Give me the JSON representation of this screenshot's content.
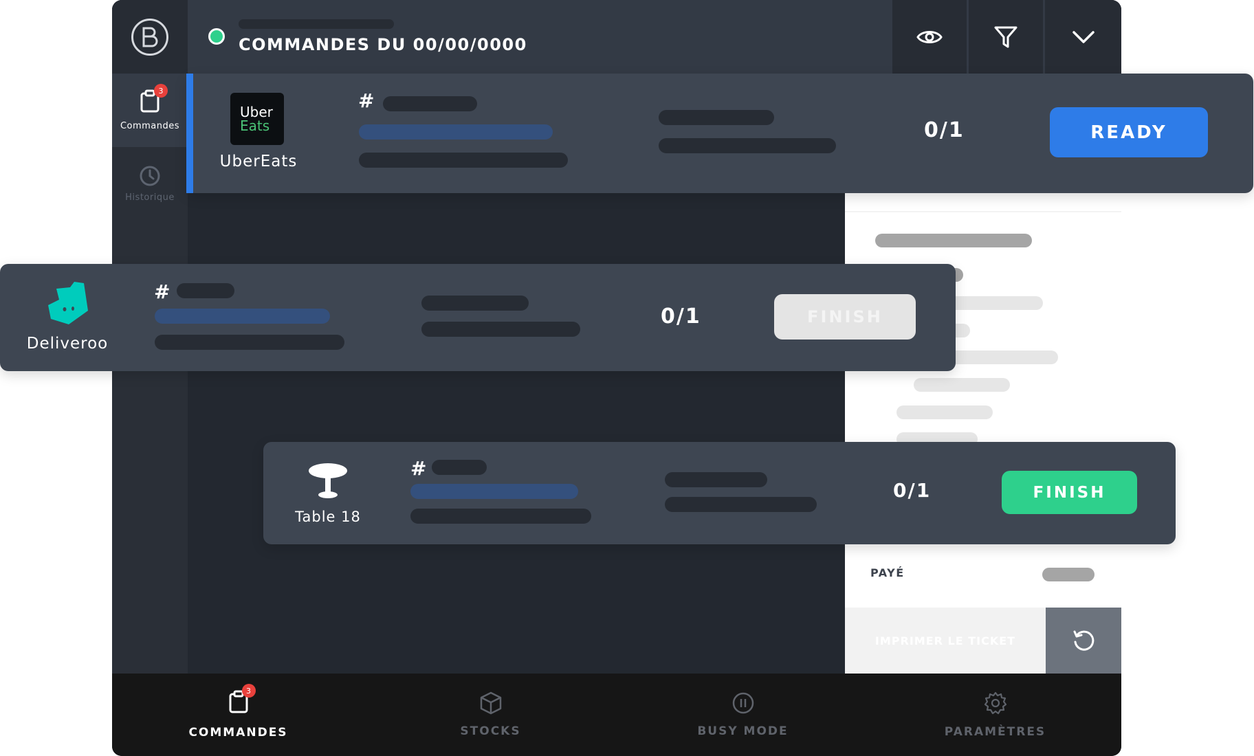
{
  "header": {
    "title": "COMMANDES DU 00/00/0000",
    "tools": [
      "eye-icon",
      "filter-icon",
      "chevron-down-icon"
    ]
  },
  "sidebar": {
    "items": [
      {
        "label": "Commandes",
        "icon": "clipboard-icon",
        "badge": "3",
        "active": true
      },
      {
        "label": "Historique",
        "icon": "clock-icon",
        "active": false
      }
    ]
  },
  "orders": [
    {
      "source": "UberEats",
      "hash": "#",
      "count": "0/1",
      "action": "READY",
      "action_color": "#2e7ce8"
    },
    {
      "source": "Deliveroo",
      "hash": "#",
      "count": "0/1",
      "action": "FINISH",
      "action_color": "#e4e4e4"
    },
    {
      "source": "Table 18",
      "hash": "#",
      "count": "0/1",
      "action": "FINISH",
      "action_color": "#2ed08c"
    }
  ],
  "logos": {
    "ubereats_line1": "Uber",
    "ubereats_line2": "Eats"
  },
  "detail": {
    "paid_label": "PAYÉ",
    "print_label": "IMPRIMER LE TICKET"
  },
  "bottom_nav": [
    {
      "label": "COMMANDES",
      "icon": "clipboard-icon",
      "badge": "3",
      "active": true
    },
    {
      "label": "STOCKS",
      "icon": "box-icon",
      "active": false
    },
    {
      "label": "BUSY MODE",
      "icon": "pause-icon",
      "active": false
    },
    {
      "label": "PARAMÈTRES",
      "icon": "gear-icon",
      "active": false
    }
  ],
  "colors": {
    "accent_blue": "#2e7ce8",
    "finish_green": "#2ed08c",
    "status_online": "#2ed08c",
    "badge_red": "#e8413c",
    "deliveroo_teal": "#00ccbc"
  }
}
